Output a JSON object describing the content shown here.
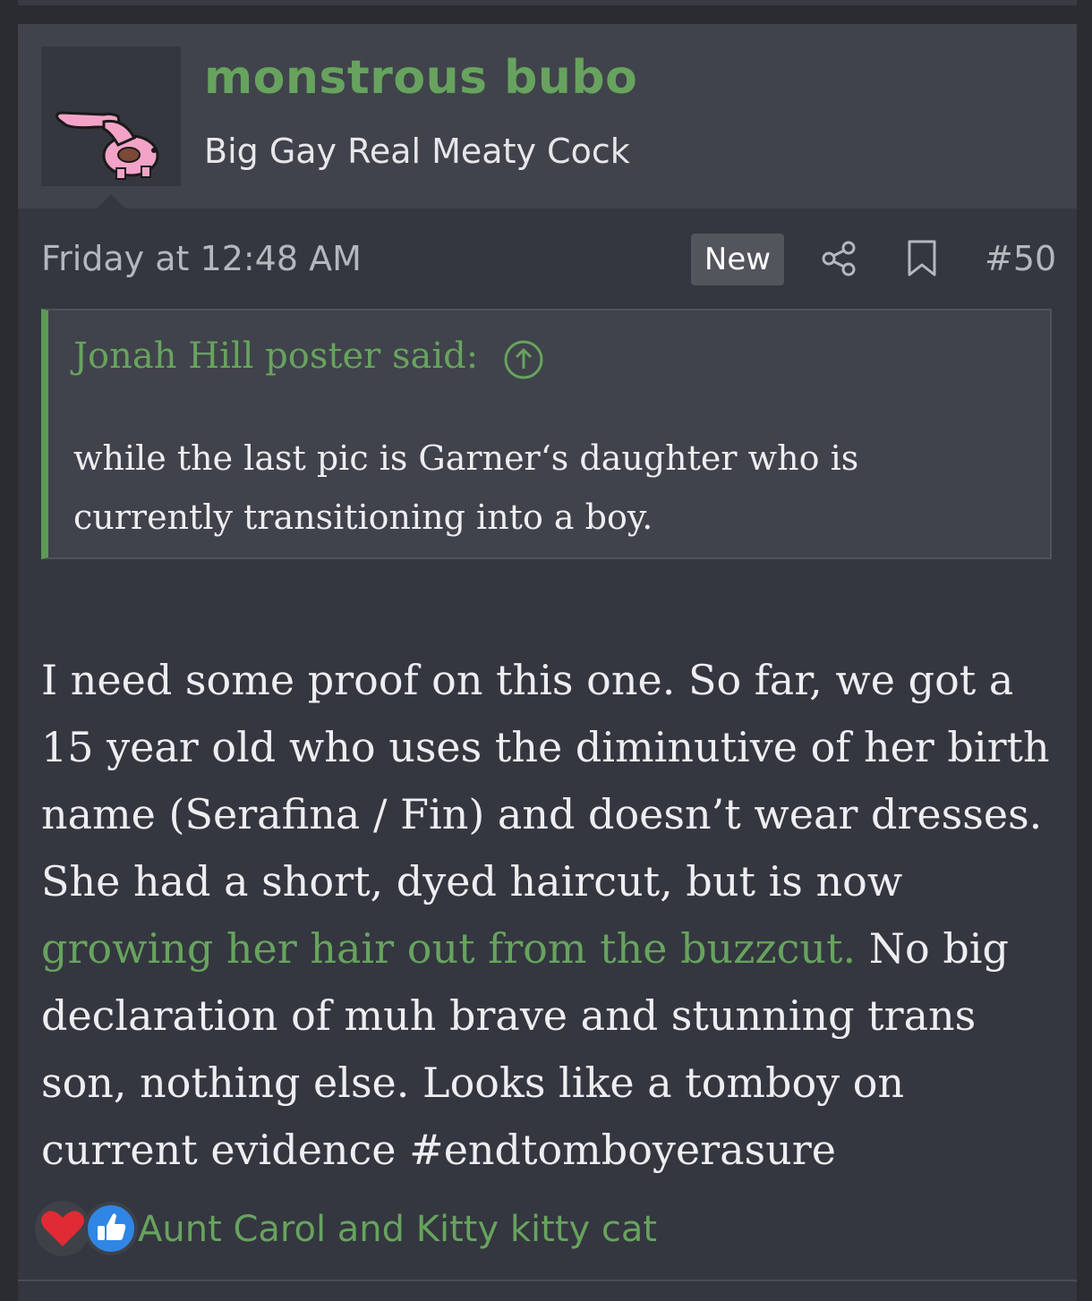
{
  "post": {
    "username": "monstrous bubo",
    "user_title": "Big Gay Real Meaty Cock",
    "date": "Friday at 12:48 AM",
    "new_badge": "New",
    "post_number": "#50",
    "icons": [
      "share-icon",
      "bookmark-icon"
    ],
    "quote": {
      "author_line": "Jonah Hill poster said:",
      "icon": "arrow-up-circle-icon",
      "body": "while the last pic is Garner‘s daughter who is currently transitioning into a boy."
    },
    "message": {
      "text_before": "I need some proof on this one. So far, we got a 15 year old who uses the diminutive of her birth name (Serafina / Fin) and doesn’t wear dresses. She had a short, dyed haircut, but is now ",
      "link_text": "growing her hair out from the buzzcut.",
      "text_after": " No big declaration of muh brave and stunning trans son, nothing else. Looks like a tomboy on current evidence #endtomboyerasure"
    },
    "reactions": {
      "icons": [
        "heart-icon",
        "like-icon"
      ],
      "users": "Aunt Carol and Kitty kitty cat"
    }
  },
  "colors": {
    "page_bg": "#2a2c31",
    "post_bg": "#34373f",
    "user_block_bg": "#40434b",
    "accent_green": "#67a35e",
    "text": "#eceef1",
    "muted": "#b4b7bd"
  }
}
